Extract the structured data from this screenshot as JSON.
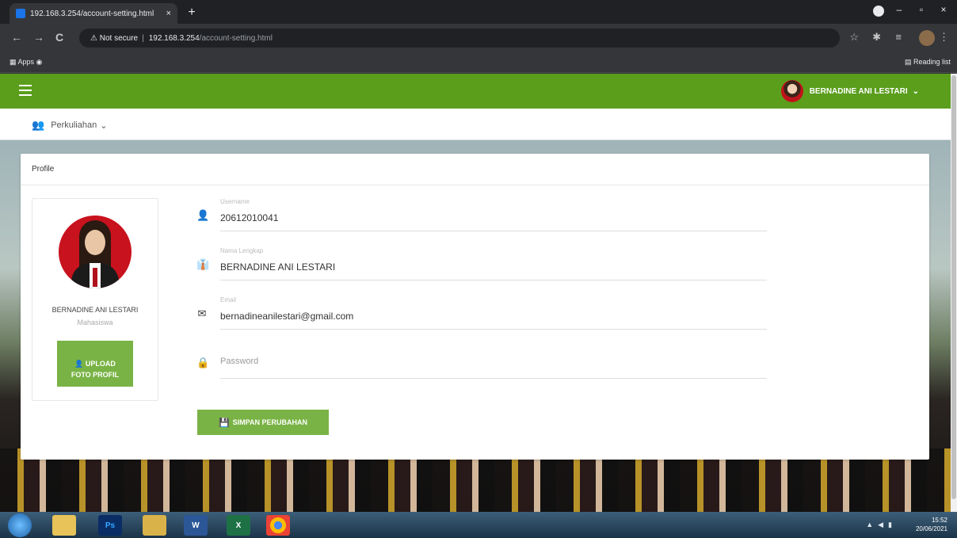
{
  "browser": {
    "tab_title": "192.168.3.254/account-setting.html",
    "tab_close": "×",
    "new_tab": "+",
    "win_min": "–",
    "win_max": "▫",
    "win_close": "×",
    "nav_back": "←",
    "nav_forward": "→",
    "nav_reload": "C",
    "security_warning": "⚠ Not secure",
    "url_host": "192.168.3.254",
    "url_path": "/account-setting.html",
    "star_icon": "☆",
    "ext_icon": "✱",
    "menu_icon": "⋮",
    "apps_label": "Apps",
    "reading_list_label": "Reading list"
  },
  "header": {
    "user_name": "BERNADINE ANI LESTARI",
    "caret": "⌄"
  },
  "subnav": {
    "menu_label": "Perkuliahan",
    "caret": "⌄"
  },
  "card": {
    "title": "Profile"
  },
  "profile": {
    "name": "BERNADINE ANI LESTARI",
    "role": "Mahasiswa",
    "upload_line1": "UPLOAD",
    "upload_line2": "FOTO PROFIL"
  },
  "form": {
    "username_label": "Username",
    "username_value": "20612010041",
    "fullname_label": "Nama Lengkap",
    "fullname_value": "BERNADINE ANI LESTARI",
    "email_label": "Email",
    "email_value": "bernadineanilestari@gmail.com",
    "password_placeholder": "Password",
    "save_label": "SIMPAN PERUBAHAN"
  },
  "taskbar": {
    "ps_label": "Ps",
    "word_label": "W",
    "excel_label": "X",
    "time": "15:52",
    "date": "20/06/2021"
  },
  "colors": {
    "brand_green": "#5a9e1c",
    "button_green": "#79b345"
  }
}
